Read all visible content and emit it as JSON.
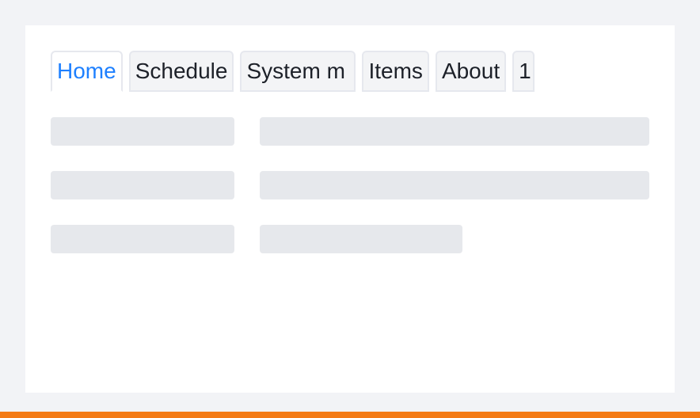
{
  "tabs": [
    {
      "label": "Home",
      "active": true
    },
    {
      "label": "Schedule",
      "active": false
    },
    {
      "label": "System m",
      "active": false
    },
    {
      "label": "Items",
      "active": false
    },
    {
      "label": "About",
      "active": false
    },
    {
      "label": "1",
      "active": false
    }
  ],
  "colors": {
    "active_tab_text": "#1e80ff",
    "tab_text": "#1d2129",
    "skeleton": "#e6e8ec",
    "page_bg": "#f2f3f6",
    "card_bg": "#ffffff",
    "bottom_bar": "#f47b16"
  }
}
